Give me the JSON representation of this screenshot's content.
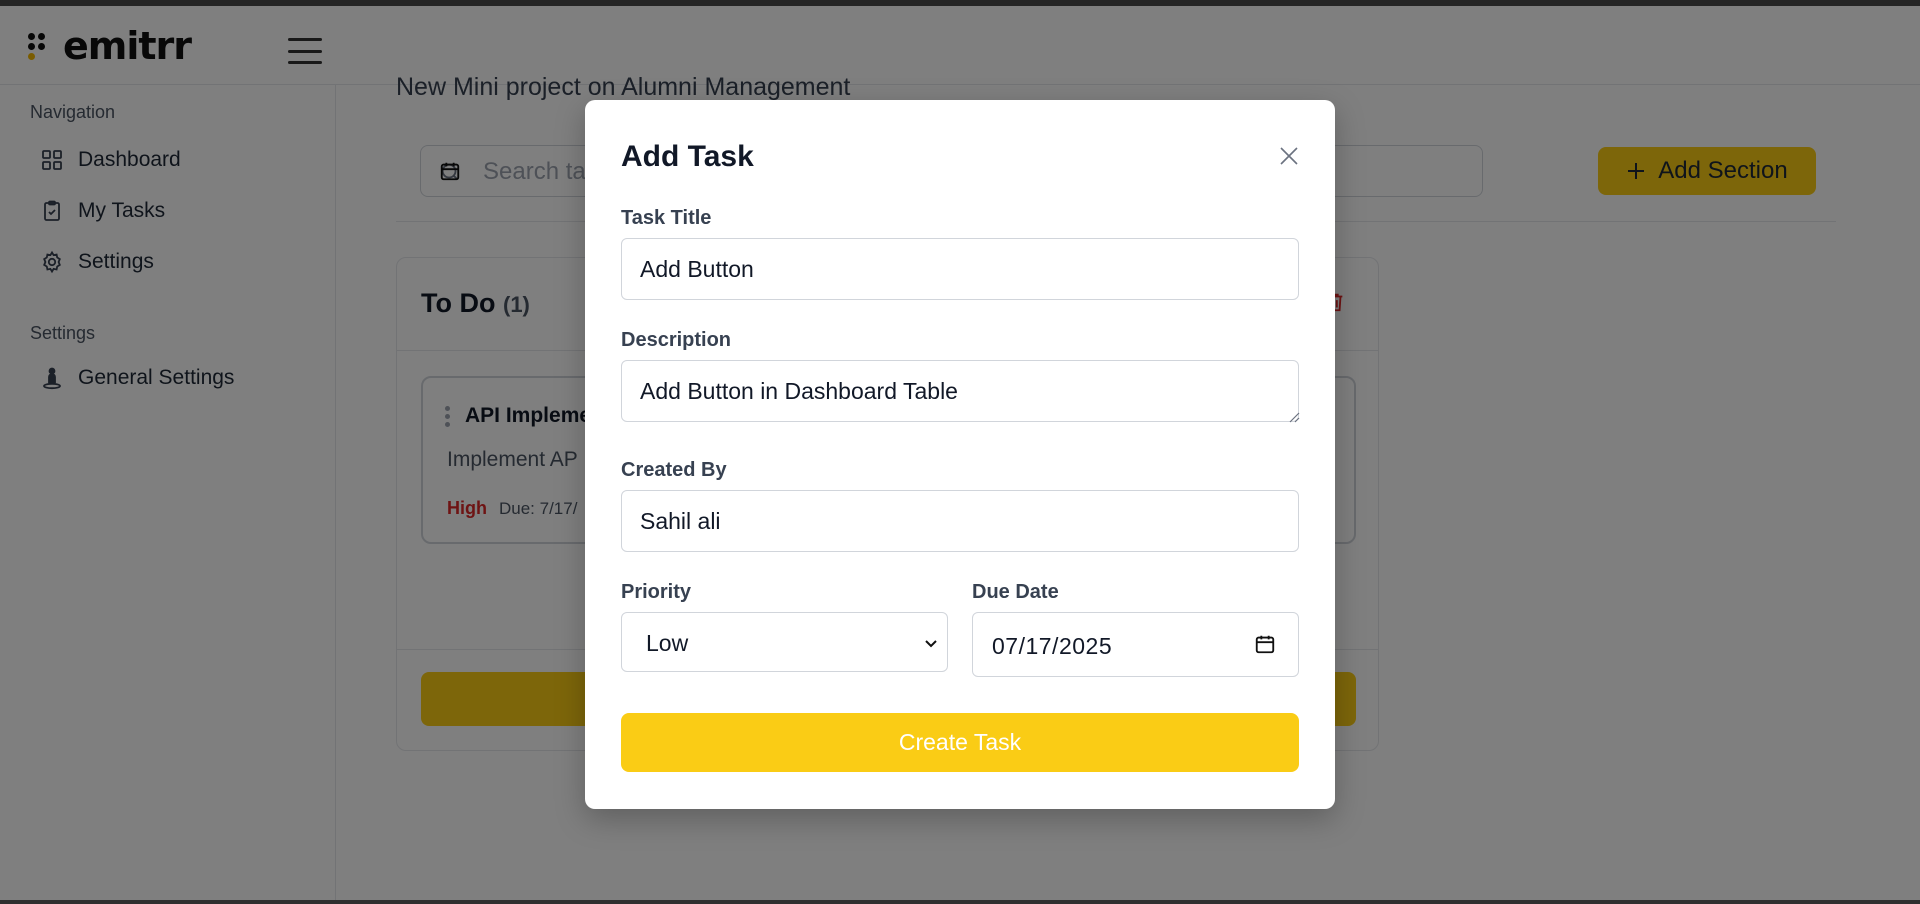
{
  "app": {
    "brand": "emitrr"
  },
  "sidebar": {
    "nav_heading": "Navigation",
    "nav_items": [
      {
        "label": "Dashboard",
        "icon": "grid-icon"
      },
      {
        "label": "My Tasks",
        "icon": "clipboard-icon"
      },
      {
        "label": "Settings",
        "icon": "gear-icon"
      }
    ],
    "settings_heading": "Settings",
    "settings_items": [
      {
        "label": "General Settings",
        "icon": "person-pin-icon"
      }
    ]
  },
  "main": {
    "project_title": "New Mini project on Alumni Management",
    "search_placeholder": "Search ta",
    "add_section_label": "Add Section",
    "column": {
      "title": "To Do",
      "count": "(1)",
      "task": {
        "title": "API Impleme",
        "description": "Implement AP",
        "priority": "High",
        "due": "Due: 7/17/"
      },
      "add_task_label": "+"
    }
  },
  "modal": {
    "title": "Add Task",
    "task_title_label": "Task Title",
    "task_title_value": "Add Button",
    "description_label": "Description",
    "description_value": "Add Button in Dashboard Table",
    "created_by_label": "Created By",
    "created_by_value": "Sahil ali",
    "priority_label": "Priority",
    "priority_value": "Low",
    "due_date_label": "Due Date",
    "due_date_value": "07/17/2025",
    "submit_label": "Create Task"
  },
  "colors": {
    "accent": "#facc15",
    "priority_high": "#dc2626",
    "overlay": "rgba(0,0,0,0.5)"
  }
}
